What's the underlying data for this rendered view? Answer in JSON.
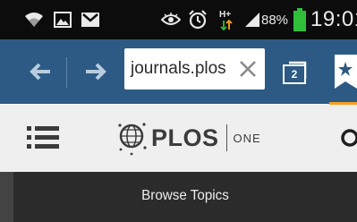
{
  "status_bar": {
    "battery_percent": "88%",
    "time": "19:01",
    "network_type_label": "H+",
    "battery_level": 0.88,
    "icons": [
      "wifi-icon",
      "gallery-icon",
      "gmail-icon",
      "eye-icon",
      "alarm-icon",
      "network-icon",
      "signal-icon",
      "battery-icon"
    ]
  },
  "browser": {
    "url": "journals.plos",
    "open_tabs": "2",
    "toolbar_color": "#2d5a84",
    "accent_color": "#f7a01c",
    "icons": [
      "back-icon",
      "forward-icon",
      "clear-icon",
      "tabs-icon",
      "bookmark-icon"
    ]
  },
  "site_header": {
    "logo_text": "PLOS",
    "logo_sub": "ONE",
    "icons": [
      "menu-icon",
      "plos-logo-icon",
      "search-icon"
    ]
  },
  "nav": {
    "browse_topics": "Browse Topics"
  }
}
